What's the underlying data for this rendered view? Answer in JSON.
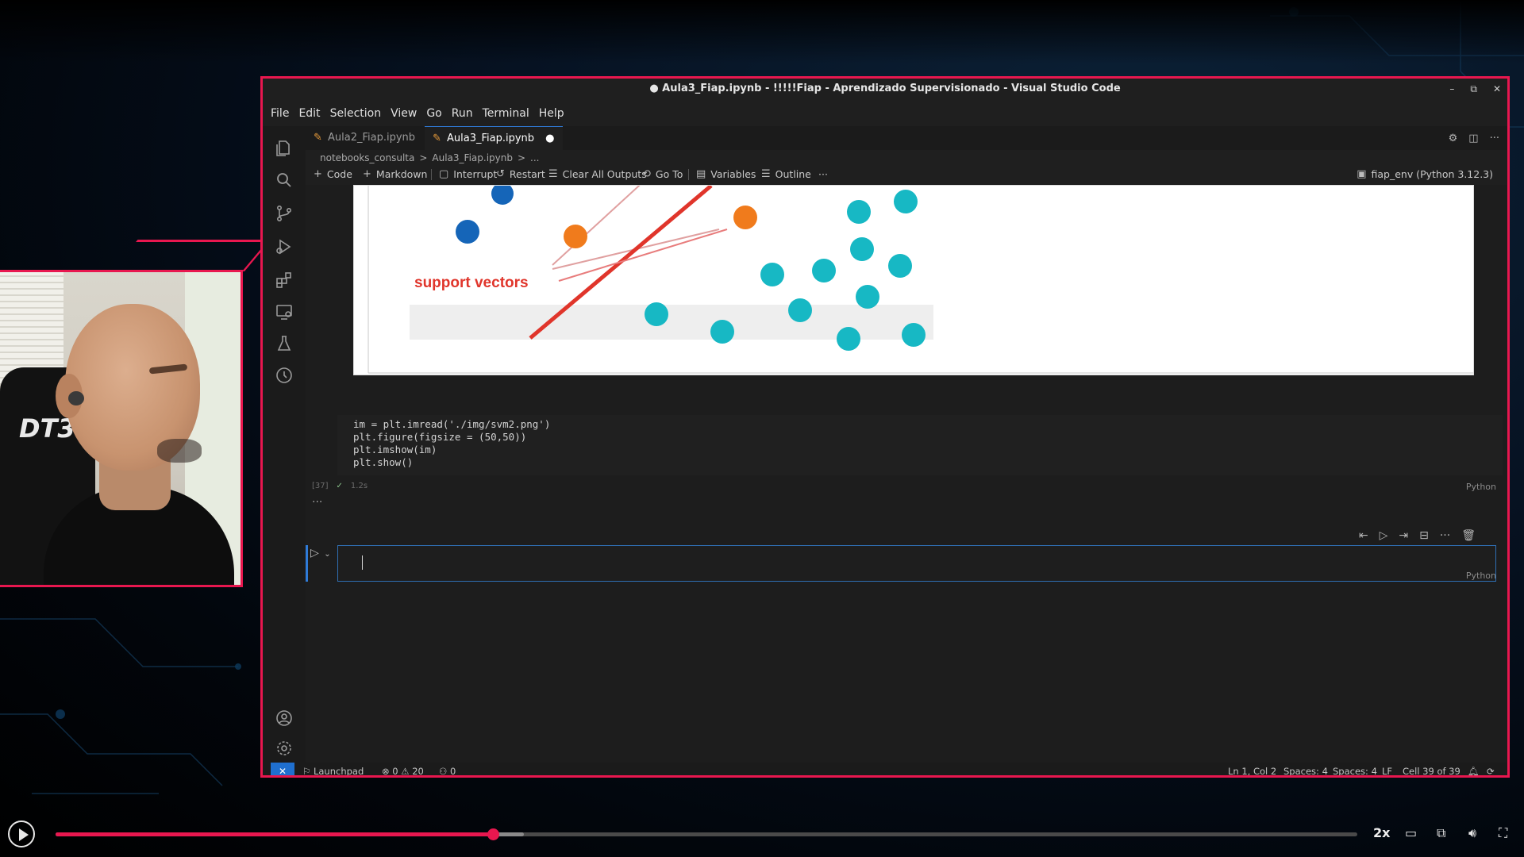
{
  "window": {
    "title": "● Aula3_Fiap.ipynb - !!!!!Fiap - Aprendizado Supervisionado - Visual Studio Code",
    "controls": [
      "–",
      "⧉",
      "✕"
    ]
  },
  "menu": [
    "File",
    "Edit",
    "Selection",
    "View",
    "Go",
    "Run",
    "Terminal",
    "Help"
  ],
  "tabs": [
    {
      "label": "Aula2_Fiap.ipynb",
      "active": false
    },
    {
      "label": "Aula3_Fiap.ipynb",
      "active": true,
      "dirty": "●"
    }
  ],
  "breadcrumb": [
    "notebooks_consulta",
    ">",
    "Aula3_Fiap.ipynb",
    ">",
    "..."
  ],
  "toolbar": {
    "code": "Code",
    "markdown": "Markdown",
    "interrupt": "Interrupt",
    "restart": "Restart",
    "clear_outputs": "Clear All Outputs",
    "goto": "Go To",
    "variables": "Variables",
    "outline": "Outline",
    "more": "···",
    "kernel": "fiap_env (Python 3.12.3)"
  },
  "output_image": {
    "label": "support vectors",
    "label_color": "#e0352b"
  },
  "code_cell": {
    "lines": [
      "im = plt.imread('./img/svm2.png')",
      "plt.figure(figsize = (50,50))",
      "plt.imshow(im)",
      "plt.show()"
    ],
    "exec_count": "[37]",
    "check": "✓",
    "duration": "1.2s",
    "language": "Python",
    "output_ellipsis": "···"
  },
  "new_cell": {
    "language": "Python",
    "run_icon": "▷",
    "chevron": "⌄"
  },
  "statusbar": {
    "remote": "✕",
    "launchpad": "Launchpad",
    "errors": "⊗ 0",
    "warnings": "⚠ 20",
    "ports": "⚇ 0",
    "position": "Ln 1, Col 2",
    "spaces1": "Spaces: 4",
    "spaces2": "Spaces: 4",
    "eol": "LF",
    "cell": "Cell 39 of 39"
  },
  "player": {
    "speed": "2x",
    "progress": 0.336,
    "buffered": 0.36
  },
  "colors": {
    "accent": "#e8174f",
    "cyan_point": "#17b8c4",
    "blue_point": "#1565b8",
    "orange_point": "#f07b1c"
  }
}
